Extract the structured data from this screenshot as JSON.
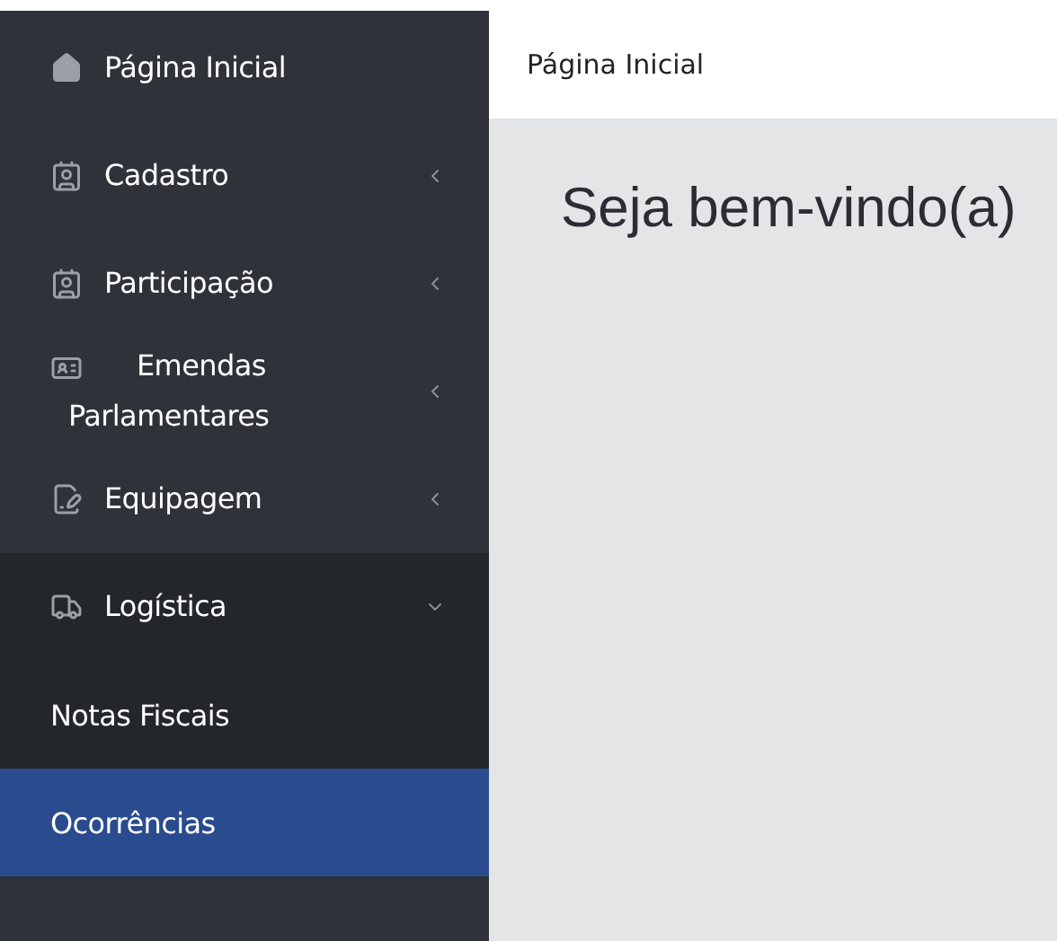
{
  "sidebar": {
    "items": [
      {
        "label": "Página Inicial"
      },
      {
        "label": "Cadastro",
        "expanded": false
      },
      {
        "label": "Participação",
        "expanded": false
      },
      {
        "label": "Emendas Parlamentares",
        "expanded": false
      },
      {
        "label": "Equipagem",
        "expanded": false
      },
      {
        "label": "Logística",
        "expanded": true,
        "children": [
          {
            "label": "Notas Fiscais",
            "selected": false
          },
          {
            "label": "Ocorrências",
            "selected": true
          }
        ]
      }
    ]
  },
  "header": {
    "breadcrumb": "Página Inicial"
  },
  "content": {
    "heading": "Seja bem-vindo(a)"
  }
}
